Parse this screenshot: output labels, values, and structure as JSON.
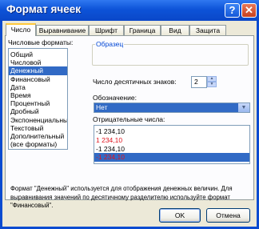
{
  "window": {
    "title": "Формат ячеек",
    "help_label": "?",
    "close_label": "✕"
  },
  "tabs": [
    {
      "label": "Число",
      "active": true
    },
    {
      "label": "Выравнивание",
      "active": false
    },
    {
      "label": "Шрифт",
      "active": false
    },
    {
      "label": "Граница",
      "active": false
    },
    {
      "label": "Вид",
      "active": false
    },
    {
      "label": "Защита",
      "active": false
    }
  ],
  "formats": {
    "label": "Числовые форматы:",
    "items": [
      "Общий",
      "Числовой",
      "Денежный",
      "Финансовый",
      "Дата",
      "Время",
      "Процентный",
      "Дробный",
      "Экспоненциальный",
      "Текстовый",
      "Дополнительный",
      "(все форматы)"
    ],
    "selected": "Денежный"
  },
  "sample": {
    "label": "Образец",
    "value": ""
  },
  "decimals": {
    "label": "Число десятичных знаков:",
    "value": "2"
  },
  "symbol": {
    "label": "Обозначение:",
    "value": "Нет"
  },
  "negative": {
    "label": "Отрицательные числа:",
    "items": [
      {
        "text": "-1 234,10",
        "color": "#000000"
      },
      {
        "text": "1 234,10",
        "color": "#e0141e"
      },
      {
        "text": "-1 234,10",
        "color": "#000000"
      },
      {
        "text": "-1 234,10",
        "color": "#e0141e"
      }
    ],
    "selected_index": 3
  },
  "description": "Формат \"Денежный\" используется для отображения денежных величин. Для выравнивания значений по десятичному разделителю используйте формат \"Финансовый\".",
  "buttons": {
    "ok": "OK",
    "cancel": "Отмена"
  },
  "colors": {
    "titlebar": "#0a4bd0",
    "selection": "#316ac5",
    "negative_red": "#e0141e",
    "group_label": "#0046d5"
  }
}
